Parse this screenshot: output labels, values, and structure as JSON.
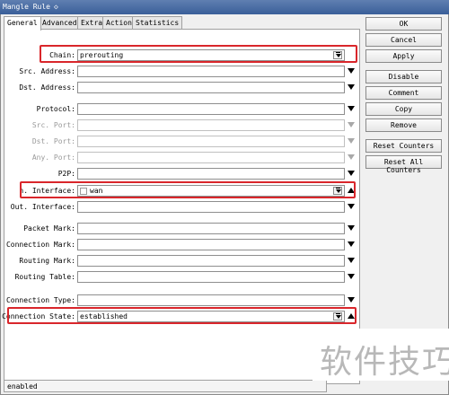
{
  "window": {
    "title": "Mangle Rule",
    "pin_glyph": "◇"
  },
  "tabs": [
    {
      "label": "General",
      "active": true
    },
    {
      "label": "Advanced",
      "active": false
    },
    {
      "label": "Extra",
      "active": false
    },
    {
      "label": "Action",
      "active": false
    },
    {
      "label": "Statistics",
      "active": false
    }
  ],
  "fields": {
    "chain": {
      "label": "Chain:",
      "value": "prerouting"
    },
    "src_address": {
      "label": "Src. Address:",
      "value": ""
    },
    "dst_address": {
      "label": "Dst. Address:",
      "value": ""
    },
    "protocol": {
      "label": "Protocol:",
      "value": ""
    },
    "src_port": {
      "label": "Src. Port:",
      "value": ""
    },
    "dst_port": {
      "label": "Dst. Port:",
      "value": ""
    },
    "any_port": {
      "label": "Any. Port:",
      "value": ""
    },
    "p2p": {
      "label": "P2P:",
      "value": ""
    },
    "in_interface": {
      "label": "n. Interface:",
      "value": "wan"
    },
    "out_interface": {
      "label": "Out. Interface:",
      "value": ""
    },
    "packet_mark": {
      "label": "Packet Mark:",
      "value": ""
    },
    "connection_mark": {
      "label": "Connection Mark:",
      "value": ""
    },
    "routing_mark": {
      "label": "Routing Mark:",
      "value": ""
    },
    "routing_table": {
      "label": "Routing Table:",
      "value": ""
    },
    "connection_type": {
      "label": "Connection Type:",
      "value": ""
    },
    "connection_state": {
      "label": "Connection State:",
      "value": "established"
    }
  },
  "buttons": {
    "ok": "OK",
    "cancel": "Cancel",
    "apply": "Apply",
    "disable": "Disable",
    "comment": "Comment",
    "copy": "Copy",
    "remove": "Remove",
    "reset_counters": "Reset Counters",
    "reset_all_counters": "Reset All Counters"
  },
  "status": {
    "text": "enabled"
  },
  "watermark": {
    "text": "软件技巧"
  },
  "colors": {
    "highlight": "#d9262b",
    "titlebar": "#3a5f99"
  }
}
